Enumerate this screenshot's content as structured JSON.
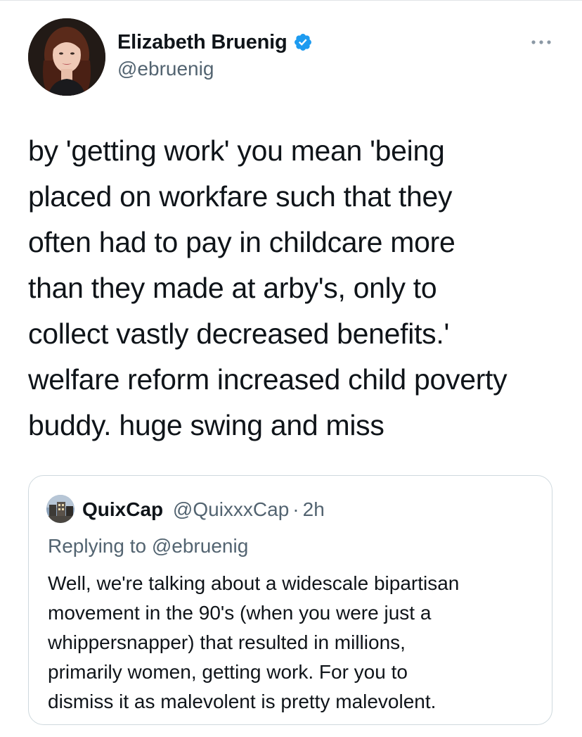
{
  "tweet": {
    "author": {
      "display_name": "Elizabeth Bruenig",
      "handle": "@ebruenig",
      "verified_icon": "verified-badge-icon",
      "avatar_icon": "profile-photo"
    },
    "more_icon": "more-options-icon",
    "text": "by 'getting work' you mean 'being\nplaced on workfare such that they\noften had to pay in childcare more\nthan they made at arby's, only to\ncollect vastly decreased benefits.'\nwelfare reform increased child poverty\nbuddy. huge swing and miss"
  },
  "quoted_tweet": {
    "display_name": "QuixCap",
    "handle": "@QuixxxCap",
    "separator": "·",
    "time": "2h",
    "replying_to": "Replying to @ebruenig",
    "text": "Well, we're talking about a widescale bipartisan\nmovement in the 90's (when you were just a\nwhippersnapper) that resulted in millions,\nprimarily women, getting work. For you to\ndismiss it as malevolent is pretty malevolent."
  },
  "colors": {
    "text_primary": "#0f1419",
    "text_secondary": "#536471",
    "verified_blue": "#1d9bf0",
    "border": "#cfd9de"
  }
}
